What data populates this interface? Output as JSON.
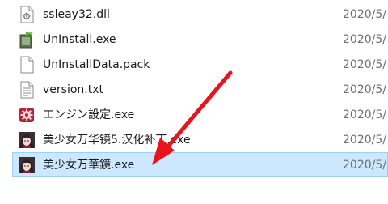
{
  "files": [
    {
      "name": "ssleay32.dll",
      "date": "2020/5/",
      "icon": "dll-file-icon"
    },
    {
      "name": "UnInstall.exe",
      "date": "2020/5/",
      "icon": "uninstaller-icon"
    },
    {
      "name": "UnInstallData.pack",
      "date": "2020/5/",
      "icon": "blank-file-icon"
    },
    {
      "name": "version.txt",
      "date": "2020/5/",
      "icon": "text-file-icon"
    },
    {
      "name": "エンジン設定.exe",
      "date": "2020/5/",
      "icon": "engine-settings-icon"
    },
    {
      "name": "美少女万华镜5.汉化补丁.exe",
      "date": "2020/5/",
      "icon": "game-character-icon"
    },
    {
      "name": "美少女万華鏡.exe",
      "date": "2020/5/",
      "icon": "game-character-icon",
      "selected": true
    }
  ],
  "colors": {
    "selection_bg": "#cce8ff",
    "selection_border": "#99d1ff",
    "annotation_arrow": "#e8141b"
  }
}
